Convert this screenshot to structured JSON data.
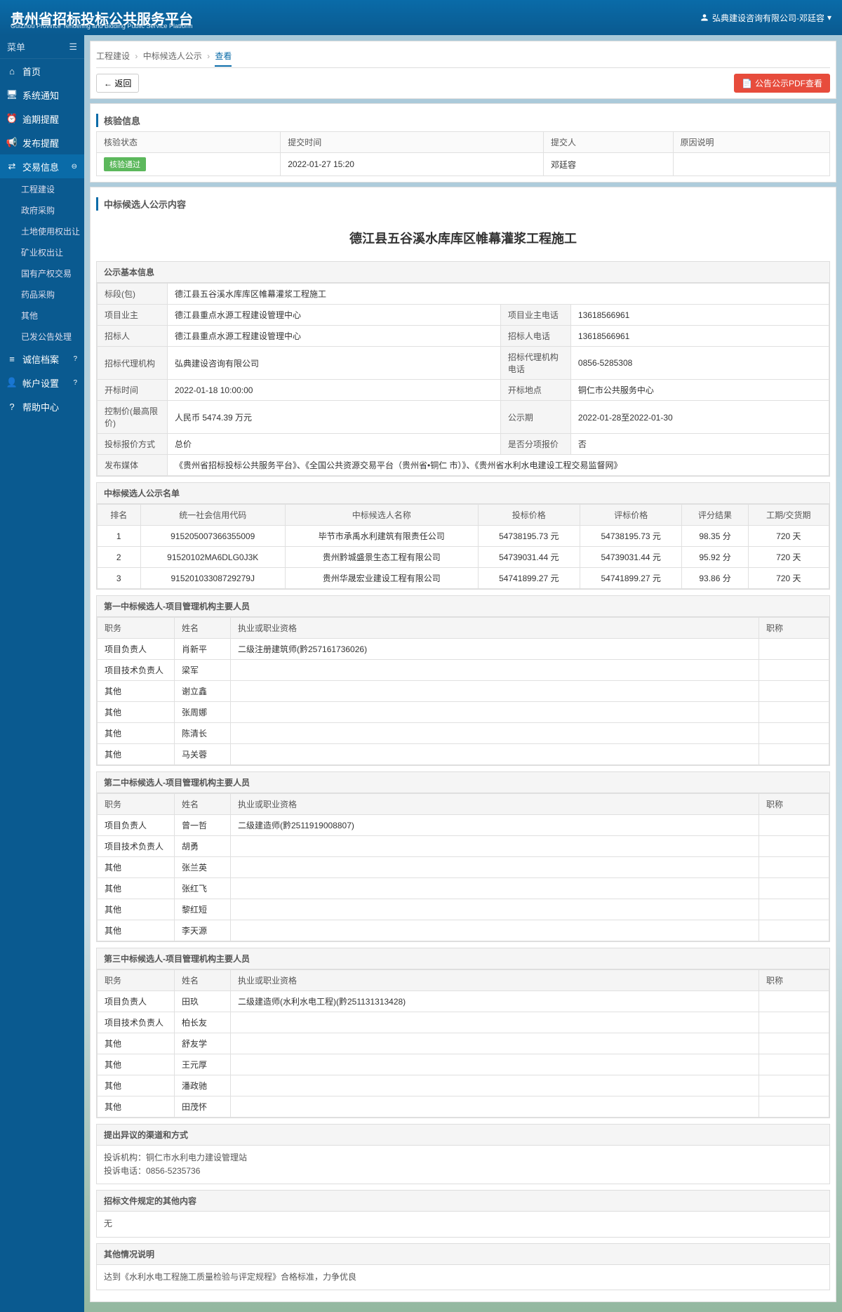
{
  "header": {
    "title_cn": "贵州省招标投标公共服务平台",
    "title_en": "GuiZhou Province Tendering and Bidding Public Service Platform",
    "user": "弘典建设咨询有限公司-邓廷容"
  },
  "sidebar": {
    "menu_label": "菜单",
    "items": [
      {
        "label": "首页"
      },
      {
        "label": "系统通知"
      },
      {
        "label": "逾期提醒"
      },
      {
        "label": "发布提醒"
      },
      {
        "label": "交易信息",
        "active": true,
        "children": [
          "工程建设",
          "政府采购",
          "土地使用权出让",
          "矿业权出让",
          "国有产权交易",
          "药品采购",
          "其他",
          "已发公告处理"
        ]
      },
      {
        "label": "诚信档案",
        "badge": "?"
      },
      {
        "label": "帐户设置",
        "badge": "?"
      },
      {
        "label": "帮助中心"
      }
    ]
  },
  "breadcrumb": {
    "a": "工程建设",
    "b": "中标候选人公示",
    "c": "查看"
  },
  "toolbar": {
    "back": "← 返回",
    "pdf": "公告公示PDF查看"
  },
  "verify": {
    "title": "核验信息",
    "cols": [
      "核验状态",
      "提交时间",
      "提交人",
      "原因说明"
    ],
    "row": {
      "status": "核验通过",
      "time": "2022-01-27 15:20",
      "person": "邓廷容",
      "reason": ""
    }
  },
  "content_title": "中标候选人公示内容",
  "project_title": "德江县五谷溪水库库区帷幕灌浆工程施工",
  "basic": {
    "title": "公示基本信息",
    "rows": [
      [
        {
          "l": "标段(包)",
          "v": "德江县五谷溪水库库区帷幕灌浆工程施工",
          "span": 3
        }
      ],
      [
        {
          "l": "项目业主",
          "v": "德江县重点水源工程建设管理中心"
        },
        {
          "l": "项目业主电话",
          "v": "13618566961"
        }
      ],
      [
        {
          "l": "招标人",
          "v": "德江县重点水源工程建设管理中心"
        },
        {
          "l": "招标人电话",
          "v": "13618566961"
        }
      ],
      [
        {
          "l": "招标代理机构",
          "v": "弘典建设咨询有限公司"
        },
        {
          "l": "招标代理机构电话",
          "v": "0856-5285308"
        }
      ],
      [
        {
          "l": "开标时间",
          "v": "2022-01-18 10:00:00"
        },
        {
          "l": "开标地点",
          "v": "铜仁市公共服务中心"
        }
      ],
      [
        {
          "l": "控制价(最高限价)",
          "v": "人民币 5474.39 万元"
        },
        {
          "l": "公示期",
          "v": "2022-01-28至2022-01-30"
        }
      ],
      [
        {
          "l": "投标报价方式",
          "v": "总价"
        },
        {
          "l": "是否分项报价",
          "v": "否"
        }
      ],
      [
        {
          "l": "发布媒体",
          "v": "《贵州省招标投标公共服务平台》、《全国公共资源交易平台（贵州省•铜仁 市）》、《贵州省水利水电建设工程交易监督网》",
          "span": 3
        }
      ]
    ]
  },
  "candidates": {
    "title": "中标候选人公示名单",
    "cols": [
      "排名",
      "统一社会信用代码",
      "中标候选人名称",
      "投标价格",
      "评标价格",
      "评分结果",
      "工期/交货期"
    ],
    "rows": [
      [
        "1",
        "915205007366355009",
        "毕节市承禹水利建筑有限责任公司",
        "54738195.73 元",
        "54738195.73 元",
        "98.35 分",
        "720 天"
      ],
      [
        "2",
        "91520102MA6DLG0J3K",
        "贵州黔城盛景生态工程有限公司",
        "54739031.44 元",
        "54739031.44 元",
        "95.92 分",
        "720 天"
      ],
      [
        "3",
        "91520103308729279J",
        "贵州华晟宏业建设工程有限公司",
        "54741899.27 元",
        "54741899.27 元",
        "93.86 分",
        "720 天"
      ]
    ]
  },
  "person_cols": [
    "职务",
    "姓名",
    "执业或职业资格",
    "职称"
  ],
  "group1": {
    "title": "第一中标候选人-项目管理机构主要人员",
    "rows": [
      [
        "项目负责人",
        "肖新平",
        "二级注册建筑师(黔257161736026)",
        ""
      ],
      [
        "项目技术负责人",
        "梁军",
        "",
        ""
      ],
      [
        "其他",
        "谢立鑫",
        "",
        ""
      ],
      [
        "其他",
        "张周娜",
        "",
        ""
      ],
      [
        "其他",
        "陈清长",
        "",
        ""
      ],
      [
        "其他",
        "马关蓉",
        "",
        ""
      ]
    ]
  },
  "group2": {
    "title": "第二中标候选人-项目管理机构主要人员",
    "rows": [
      [
        "项目负责人",
        "曾一哲",
        "二级建造师(黔2511919008807)",
        ""
      ],
      [
        "项目技术负责人",
        "胡勇",
        "",
        ""
      ],
      [
        "其他",
        "张兰英",
        "",
        ""
      ],
      [
        "其他",
        "张红飞",
        "",
        ""
      ],
      [
        "其他",
        "黎红短",
        "",
        ""
      ],
      [
        "其他",
        "李天源",
        "",
        ""
      ]
    ]
  },
  "group3": {
    "title": "第三中标候选人-项目管理机构主要人员",
    "rows": [
      [
        "项目负责人",
        "田玖",
        "二级建造师(水利水电工程)(黔251131313428)",
        ""
      ],
      [
        "项目技术负责人",
        "柏长友",
        "",
        ""
      ],
      [
        "其他",
        "舒友学",
        "",
        ""
      ],
      [
        "其他",
        "王元厚",
        "",
        ""
      ],
      [
        "其他",
        "潘政驰",
        "",
        ""
      ],
      [
        "其他",
        "田茂怀",
        "",
        ""
      ]
    ]
  },
  "objection": {
    "title": "提出异议的渠道和方式",
    "line1": "投诉机构：铜仁市水利电力建设管理站",
    "line2": "投诉电话：0856-5235736"
  },
  "other_doc": {
    "title": "招标文件规定的其他内容",
    "body": "无"
  },
  "other_info": {
    "title": "其他情况说明",
    "body": "达到《水利水电工程施工质量检验与评定规程》合格标准，力争优良"
  }
}
